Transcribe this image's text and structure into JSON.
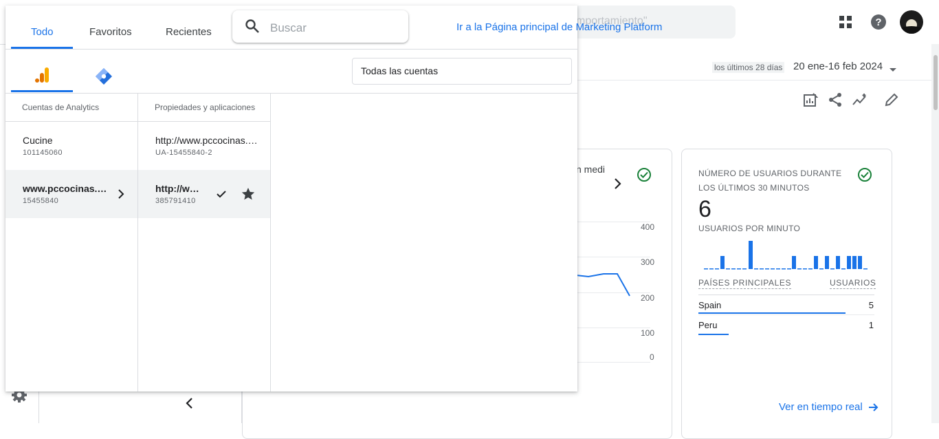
{
  "background": {
    "search_partial": "mportamiento\"",
    "date_prefix": "los últimos 28 días",
    "date_range": "20 ene-16 feb 2024",
    "chart_partial_text": "n medi",
    "y_ticks": [
      "400",
      "300",
      "200",
      "100",
      "0"
    ],
    "realtime": {
      "title": "NÚMERO DE USUARIOS DURANTE LOS ÚLTIMOS 30 MINUTOS",
      "count": "6",
      "per_minute_label": "USUARIOS POR MINUTO",
      "countries_header": "PAÍSES PRINCIPALES",
      "users_header": "USUARIOS",
      "countries": [
        {
          "name": "Spain",
          "value": "5"
        },
        {
          "name": "Peru",
          "value": "1"
        }
      ],
      "link": "Ver en tiempo real"
    }
  },
  "picker": {
    "tabs": [
      {
        "label": "Todo",
        "active": true
      },
      {
        "label": "Favoritos",
        "active": false
      },
      {
        "label": "Recientes",
        "active": false
      }
    ],
    "search_placeholder": "Buscar",
    "marketing_link": "Ir a la Página principal de Marketing Platform",
    "products": [
      {
        "icon": "google-analytics-icon",
        "active": true
      },
      {
        "icon": "tag-manager-icon",
        "active": false
      }
    ],
    "account_filter": "Todas las cuentas",
    "columns": {
      "accounts_header": "Cuentas de Analytics",
      "properties_header": "Propiedades y aplicaciones"
    },
    "accounts": [
      {
        "name": "Cucine",
        "id": "101145060",
        "selected": false
      },
      {
        "name": "www.pccocinas.com",
        "id": "15455840",
        "selected": true
      }
    ],
    "properties": [
      {
        "name": "http://www.pccocinas.com/",
        "id": "UA-15455840-2",
        "selected": false
      },
      {
        "name": "http://www.pccocinas.com",
        "id": "385791410",
        "selected": true
      }
    ]
  },
  "colors": {
    "accent": "#1a73e8",
    "analytics_orange": "#f9ab00",
    "analytics_dark": "#e37400",
    "gtm_blue": "#246fdb",
    "success": "#188038"
  }
}
